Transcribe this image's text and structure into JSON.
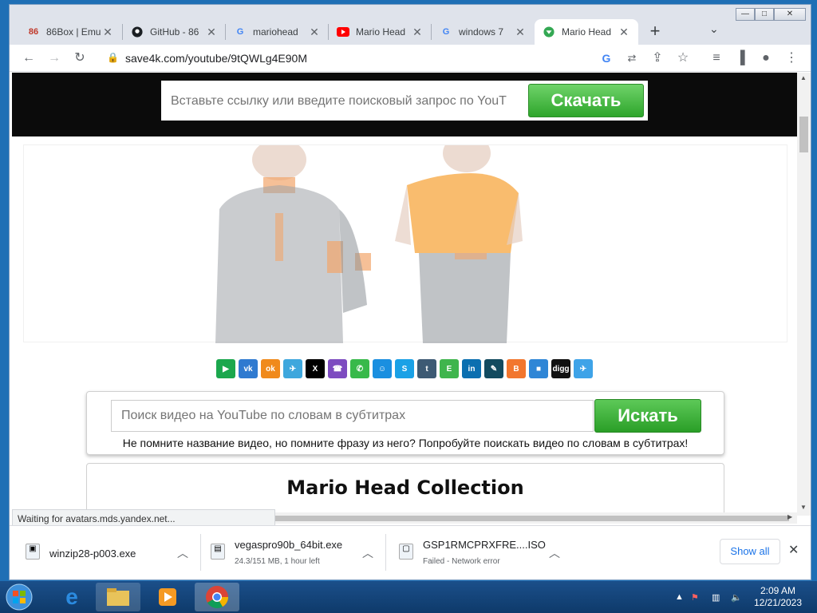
{
  "browser": {
    "tabs": [
      {
        "title": "86Box | Emu",
        "icon": "86box-icon"
      },
      {
        "title": "GitHub - 86",
        "icon": "github-icon"
      },
      {
        "title": "mariohead",
        "icon": "google-icon"
      },
      {
        "title": "Mario Head",
        "icon": "youtube-icon"
      },
      {
        "title": "windows 7",
        "icon": "google-icon"
      },
      {
        "title": "Mario Head",
        "icon": "save4k-icon",
        "active": true
      }
    ],
    "url": "save4k.com/youtube/9tQWLg4E90M",
    "new_tab_label": "+"
  },
  "page": {
    "hero_search_placeholder": "Вставьте ссылку или введите поисковый запрос по YouT",
    "hero_button": "Скачать",
    "sub_search_placeholder": "Поиск видео на YouTube по словам в субтитрах",
    "sub_search_button": "Искать",
    "sub_search_hint": "Не помните название видео, но помните фразу из него? Попробуйте поискать видео по словам в субтитрах!",
    "collection_title": "Mario Head Collection",
    "share_buttons": [
      {
        "name": "share-button-1",
        "color": "#1ba74d",
        "glyph": "▶"
      },
      {
        "name": "share-button-vk",
        "color": "#2f7ad0",
        "glyph": "vk"
      },
      {
        "name": "share-button-ok",
        "color": "#f08a1c",
        "glyph": "ok"
      },
      {
        "name": "share-button-telegram",
        "color": "#3ea7dd",
        "glyph": "✈"
      },
      {
        "name": "share-button-x",
        "color": "#000000",
        "glyph": "X"
      },
      {
        "name": "share-button-viber",
        "color": "#7d4bc0",
        "glyph": "☎"
      },
      {
        "name": "share-button-whatsapp",
        "color": "#38b94a",
        "glyph": "✆"
      },
      {
        "name": "share-button-mymail",
        "color": "#1a8fe0",
        "glyph": "☺"
      },
      {
        "name": "share-button-skype",
        "color": "#1aa1e6",
        "glyph": "S"
      },
      {
        "name": "share-button-tumblr",
        "color": "#3d5a74",
        "glyph": "t"
      },
      {
        "name": "share-button-evernote",
        "color": "#3fb54d",
        "glyph": "E"
      },
      {
        "name": "share-button-linkedin",
        "color": "#0b6fb0",
        "glyph": "in"
      },
      {
        "name": "share-button-livejournal",
        "color": "#124a5f",
        "glyph": "✎"
      },
      {
        "name": "share-button-blogger",
        "color": "#f2762e",
        "glyph": "B"
      },
      {
        "name": "share-button-delicious",
        "color": "#2f86d6",
        "glyph": "■"
      },
      {
        "name": "share-button-digg",
        "color": "#111111",
        "glyph": "digg"
      },
      {
        "name": "share-button-twitter",
        "color": "#3ea3e8",
        "glyph": "✈"
      }
    ]
  },
  "status_bar": "Waiting for avatars.mds.yandex.net...",
  "downloads": [
    {
      "name": "winzip28-p003.exe",
      "status": ""
    },
    {
      "name": "vegaspro90b_64bit.exe",
      "status": "24.3/151 MB, 1 hour left"
    },
    {
      "name": "GSP1RMCPRXFRE....ISO",
      "status": "Failed - Network error"
    }
  ],
  "shelf": {
    "show_all": "Show all"
  },
  "taskbar": {
    "time": "2:09 AM",
    "date": "12/21/2023"
  }
}
